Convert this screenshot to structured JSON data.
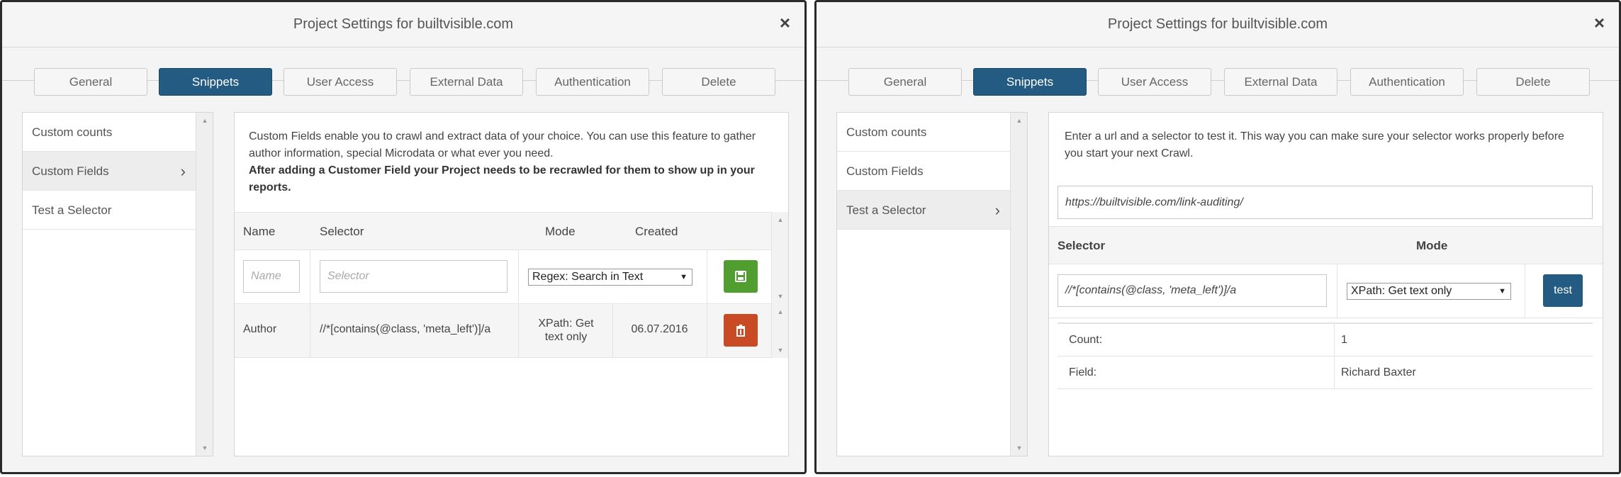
{
  "left_panel": {
    "title": "Project Settings for builtvisible.com",
    "close_glyph": "×",
    "tabs": [
      {
        "label": "General",
        "active": false
      },
      {
        "label": "Snippets",
        "active": true
      },
      {
        "label": "User Access",
        "active": false
      },
      {
        "label": "External Data",
        "active": false
      },
      {
        "label": "Authentication",
        "active": false
      },
      {
        "label": "Delete",
        "active": false
      }
    ],
    "sidebar": [
      {
        "label": "Custom counts",
        "active": false
      },
      {
        "label": "Custom Fields",
        "active": true
      },
      {
        "label": "Test a Selector",
        "active": false
      }
    ],
    "intro": "Custom Fields enable you to crawl and extract data of your choice. You can use this feature to gather author information, special Microdata or what ever you need.",
    "intro_bold": "After adding a Customer Field your Project needs to be recrawled for them to show up in your reports.",
    "table": {
      "headers": {
        "name": "Name",
        "selector": "Selector",
        "mode": "Mode",
        "created": "Created"
      },
      "new_row": {
        "name_placeholder": "Name",
        "selector_placeholder": "Selector",
        "mode_value": "Regex: Search in Text"
      },
      "rows": [
        {
          "name": "Author",
          "selector": "//*[contains(@class, 'meta_left')]/a",
          "mode": "XPath: Get text only",
          "created": "06.07.2016"
        }
      ]
    },
    "icons": {
      "save": "save-icon",
      "delete": "trash-icon",
      "chevron": "chevron-right-icon"
    },
    "colors": {
      "accent": "#235b82",
      "save": "#4f9e2f",
      "delete": "#c84b26"
    }
  },
  "right_panel": {
    "title": "Project Settings for builtvisible.com",
    "close_glyph": "×",
    "tabs": [
      {
        "label": "General",
        "active": false
      },
      {
        "label": "Snippets",
        "active": true
      },
      {
        "label": "User Access",
        "active": false
      },
      {
        "label": "External Data",
        "active": false
      },
      {
        "label": "Authentication",
        "active": false
      },
      {
        "label": "Delete",
        "active": false
      }
    ],
    "sidebar": [
      {
        "label": "Custom counts",
        "active": false
      },
      {
        "label": "Custom Fields",
        "active": false
      },
      {
        "label": "Test a Selector",
        "active": true
      }
    ],
    "intro": "Enter a url and a selector to test it. This way you can make sure your selector works properly before you start your next Crawl.",
    "url_value": "https://builtvisible.com/link-auditing/",
    "test_table": {
      "headers": {
        "selector": "Selector",
        "mode": "Mode"
      },
      "selector_value": "//*[contains(@class, 'meta_left')]/a",
      "mode_value": "XPath: Get text only",
      "test_label": "test"
    },
    "results": [
      {
        "label": "Count:",
        "value": "1"
      },
      {
        "label": "Field:",
        "value": "Richard Baxter"
      }
    ]
  }
}
